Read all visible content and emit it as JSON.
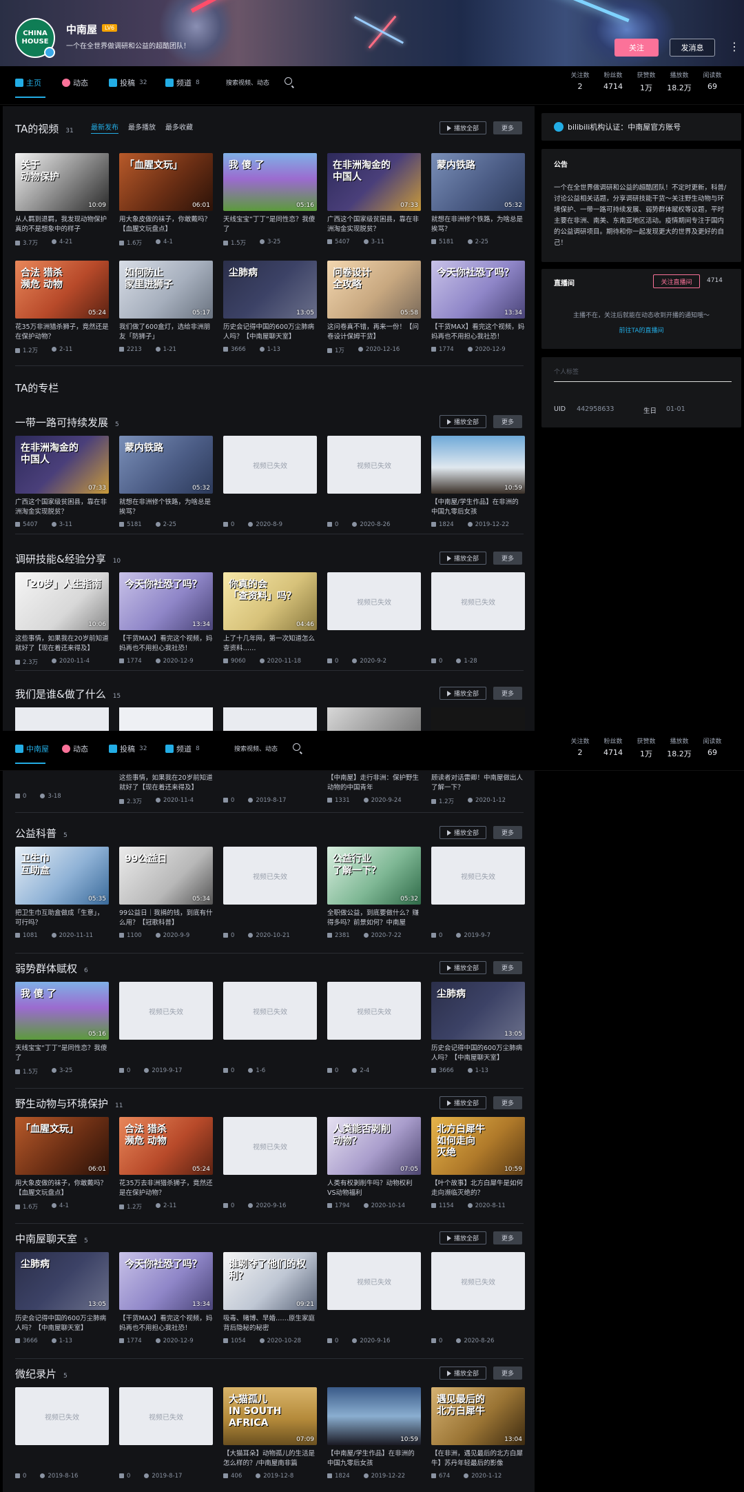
{
  "banner": {
    "avatar_text": "CHINA HOUSE",
    "name": "中南屋",
    "level": "LV6",
    "sign": "一个在全世界做调研和公益的超酷团队！"
  },
  "actions": {
    "follow": "关注",
    "message": "发消息",
    "more": "⋮"
  },
  "nav": {
    "items": [
      {
        "label": "主页",
        "count": ""
      },
      {
        "label": "动态",
        "count": ""
      },
      {
        "label": "投稿",
        "count": "32"
      },
      {
        "label": "频道",
        "count": "8"
      }
    ],
    "items2": [
      {
        "label": "中南屋",
        "count": ""
      },
      {
        "label": "动态",
        "count": ""
      },
      {
        "label": "投稿",
        "count": "32"
      },
      {
        "label": "频道",
        "count": "8"
      }
    ],
    "search_placeholder": "搜索视频、动态",
    "stats": [
      {
        "k": "关注数",
        "v": "2"
      },
      {
        "k": "粉丝数",
        "v": "4714"
      },
      {
        "k": "获赞数",
        "v": "1万"
      },
      {
        "k": "播放数",
        "v": "18.2万"
      },
      {
        "k": "阅读数",
        "v": "69"
      }
    ]
  },
  "videos_section": {
    "title": "TA的视频",
    "count": "31",
    "tabs": [
      "最新发布",
      "最多播放",
      "最多收藏"
    ],
    "play_all": "播放全部",
    "more": "更多"
  },
  "videos": [
    {
      "t": "从人羁到退羁，我发现动物保护真的不是想象中的样子",
      "thumb": "关于\n动物保护",
      "dur": "10:09",
      "p": "3.7万",
      "d": "4-21",
      "bg": "linear-gradient(135deg,#f2f2f2 0%,#9a9a9a 45%,#2a2a2a 100%)"
    },
    {
      "t": "用大象皮做的袜子，你敢戴吗？【血腥文玩盘点】",
      "thumb": "「血腥文玩」",
      "dur": "06:01",
      "p": "1.6万",
      "d": "4-1",
      "bg": "linear-gradient(135deg,#b85a2a 0%,#6a2e14 55%,#2b1208 100%)"
    },
    {
      "t": "天线宝宝“丁丁”是同性恋？我傻了",
      "thumb": "我 傻 了",
      "dur": "05:16",
      "p": "1.5万",
      "d": "3-25",
      "bg": "linear-gradient(180deg,#7fb0e6 0%,#9b6bcf 45%,#5c9b3c 100%)"
    },
    {
      "t": "广西这个国家级贫困县，靠在非洲淘金实现脱贫？",
      "thumb": "在非洲淘金的\n中国人",
      "dur": "07:33",
      "p": "5407",
      "d": "3-11",
      "bg": "linear-gradient(135deg,#2d2a5a 0%,#4a3f7a 50%,#c89a3a 100%)"
    },
    {
      "t": "就想在非洲修个铁路，为啥总是挨骂？",
      "thumb": "蒙内铁路",
      "dur": "05:32",
      "p": "5181",
      "d": "2-25",
      "bg": "linear-gradient(135deg,#7a8fb8 0%,#4c5d86 55%,#2c3a5a 100%)"
    },
    {
      "t": "花35万非洲猎杀狮子，竟然还是在保护动物？",
      "thumb": "合法 猎杀\n濒危 动物",
      "dur": "05:24",
      "p": "1.2万",
      "d": "2-11",
      "bg": "linear-gradient(135deg,#e8875a 0%,#b84a2a 55%,#5a2212 100%)"
    },
    {
      "t": "我们做了600盒灯，选给非洲朋友「防狮子」",
      "thumb": "如何防止\n家里进狮子",
      "dur": "05:17",
      "p": "2213",
      "d": "1-21",
      "bg": "linear-gradient(135deg,#d8dde6 0%,#a6afbd 55%,#6a7380 100%)"
    },
    {
      "t": "历史会记得中国的600万尘肺病人吗？【中南屋聊天室】",
      "thumb": "尘肺病",
      "dur": "13:05",
      "p": "3666",
      "d": "1-13",
      "bg": "linear-gradient(135deg,#2b2f4a 0%,#3c4266 50%,#6a6f8a 100%)"
    },
    {
      "t": "这问卷真不错，再来一份！【问卷设计保姆干货】",
      "thumb": "问卷设计\n全攻略",
      "dur": "05:58",
      "p": "1万",
      "d": "2020-12-16",
      "bg": "linear-gradient(135deg,#f3d7b0 0%,#c8a880 55%,#7a6a5a 100%)"
    },
    {
      "t": "【干货MAX】看完这个视频，妈妈再也不用担心我社恐！",
      "thumb": "今天你社恐了吗？",
      "dur": "13:34",
      "p": "1774",
      "d": "2020-12-9",
      "bg": "linear-gradient(135deg,#c8c2e8 0%,#8f86c8 55%,#4a4478 100%)"
    }
  ],
  "column_title": "TA的专栏",
  "collections": [
    {
      "title": "一带一路可持续发展",
      "count": "5",
      "cards": [
        {
          "t": "广西这个国家级贫困县，靠在非洲淘金实现脱贫？",
          "thumb": "在非洲淘金的\n中国人",
          "dur": "07:33",
          "p": "5407",
          "d": "3-11",
          "bg": "linear-gradient(135deg,#2d2a5a 0%,#4a3f7a 50%,#c89a3a 100%)",
          "inv": ""
        },
        {
          "t": "就想在非洲修个铁路，为啥总是挨骂？",
          "thumb": "蒙内铁路",
          "dur": "05:32",
          "p": "5181",
          "d": "2-25",
          "bg": "linear-gradient(135deg,#7a8fb8 0%,#4c5d86 55%,#2c3a5a 100%)",
          "inv": ""
        },
        {
          "t": "",
          "thumb": "",
          "dur": "",
          "p": "0",
          "d": "2020-8-9",
          "bg": "",
          "inv": "视频已失效"
        },
        {
          "t": "",
          "thumb": "",
          "dur": "",
          "p": "0",
          "d": "2020-8-26",
          "bg": "",
          "inv": "视频已失效"
        },
        {
          "t": "【中南屋/学生作品】在非洲的中国九零后女孩",
          "thumb": "",
          "dur": "10:59",
          "p": "1824",
          "d": "2019-12-22",
          "bg": "linear-gradient(180deg,#6fa9d8 0%,#e0e8ef 55%,#3a3028 100%)",
          "inv": ""
        }
      ]
    },
    {
      "title": "调研技能&经验分享",
      "count": "10",
      "cards": [
        {
          "t": "这些事情，如果我在20岁前知道就好了【现在着还来得及】",
          "thumb": "「20岁」人生指南",
          "dur": "10:06",
          "p": "2.3万",
          "d": "2020-11-4",
          "bg": "linear-gradient(135deg,#f5f5f5 0%,#d8d8d8 60%,#8a8a8a 100%)",
          "inv": ""
        },
        {
          "t": "【干货MAX】看完这个视频，妈妈再也不用担心我社恐！",
          "thumb": "今天你社恐了吗？",
          "dur": "13:34",
          "p": "1774",
          "d": "2020-12-9",
          "bg": "linear-gradient(135deg,#c8c2e8 0%,#8f86c8 55%,#4a4478 100%)",
          "inv": ""
        },
        {
          "t": "上了十几年网，第一次知道怎么查资料……",
          "thumb": "你真的会\n「查资料」吗？",
          "dur": "04:46",
          "p": "9060",
          "d": "2020-11-18",
          "bg": "linear-gradient(135deg,#f6e7a8 0%,#d7c27a 55%,#8a7a40 100%)",
          "inv": ""
        },
        {
          "t": "",
          "thumb": "",
          "dur": "",
          "p": "0",
          "d": "2020-9-2",
          "bg": "",
          "inv": "视频已失效"
        },
        {
          "t": "",
          "thumb": "",
          "dur": "",
          "p": "0",
          "d": "1-28",
          "bg": "",
          "inv": "视频已失效"
        }
      ]
    },
    {
      "title": "我们是谁&做了什么",
      "count": "15",
      "cards": []
    },
    {
      "title": "公益科普",
      "count": "5",
      "cards": [
        {
          "t": "把卫生巾互助盒做成「生意」，可行吗？",
          "thumb": "卫生巾\n互助盒",
          "dur": "05:35",
          "p": "1081",
          "d": "2020-11-11",
          "bg": "linear-gradient(135deg,#e6eef6 0%,#8fb2d6 55%,#3a6a9a 100%)",
          "inv": ""
        },
        {
          "t": "99公益日｜我捐的钱，到底有什么用？【冠歌科普】",
          "thumb": "99公益日",
          "dur": "05:34",
          "p": "1100",
          "d": "2020-9-9",
          "bg": "linear-gradient(135deg,#ebebeb 0%,#b8b8b8 60%,#555 100%)",
          "inv": ""
        },
        {
          "t": "",
          "thumb": "",
          "dur": "",
          "p": "0",
          "d": "2020-10-21",
          "bg": "",
          "inv": "视频已失效"
        },
        {
          "t": "全职做公益，到底要做什么？赚得多吗？前景如何？中南屋",
          "thumb": "公益行业\n了解一下？",
          "dur": "05:32",
          "p": "2381",
          "d": "2020-7-22",
          "bg": "linear-gradient(135deg,#d9efe0 0%,#7fb895 55%,#2f6a48 100%)",
          "inv": ""
        },
        {
          "t": "",
          "thumb": "",
          "dur": "",
          "p": "0",
          "d": "2019-9-7",
          "bg": "",
          "inv": "视频已失效"
        }
      ]
    },
    {
      "title": "弱势群体赋权",
      "count": "6",
      "cards": [
        {
          "t": "天线宝宝“丁丁”是同性恋？我傻了",
          "thumb": "我 傻 了",
          "dur": "05:16",
          "p": "1.5万",
          "d": "3-25",
          "bg": "linear-gradient(180deg,#7fb0e6 0%,#9b6bcf 45%,#5c9b3c 100%)",
          "inv": ""
        },
        {
          "t": "",
          "thumb": "",
          "dur": "",
          "p": "0",
          "d": "2019-9-17",
          "bg": "",
          "inv": "视频已失效"
        },
        {
          "t": "",
          "thumb": "",
          "dur": "",
          "p": "0",
          "d": "1-6",
          "bg": "",
          "inv": "视频已失效"
        },
        {
          "t": "",
          "thumb": "",
          "dur": "",
          "p": "0",
          "d": "2-4",
          "bg": "",
          "inv": "视频已失效"
        },
        {
          "t": "历史会记得中国的600万尘肺病人吗？【中南屋聊天室】",
          "thumb": "尘肺病",
          "dur": "13:05",
          "p": "3666",
          "d": "1-13",
          "bg": "linear-gradient(135deg,#2b2f4a 0%,#3c4266 50%,#6a6f8a 100%)",
          "inv": ""
        }
      ]
    },
    {
      "title": "野生动物与环境保护",
      "count": "11",
      "cards": [
        {
          "t": "用大象皮做的袜子，你敢戴吗？【血腥文玩盘点】",
          "thumb": "「血腥文玩」",
          "dur": "06:01",
          "p": "1.6万",
          "d": "4-1",
          "bg": "linear-gradient(135deg,#b85a2a 0%,#6a2e14 55%,#2b1208 100%)",
          "inv": ""
        },
        {
          "t": "花35万去非洲猎杀狮子，竟然还是在保护动物？",
          "thumb": "合法 猎杀\n濒危 动物",
          "dur": "05:24",
          "p": "1.2万",
          "d": "2-11",
          "bg": "linear-gradient(135deg,#e8875a 0%,#b84a2a 55%,#5a2212 100%)",
          "inv": ""
        },
        {
          "t": "",
          "thumb": "",
          "dur": "",
          "p": "0",
          "d": "2020-9-16",
          "bg": "",
          "inv": "视频已失效"
        },
        {
          "t": "人类有权剥削牛吗？动物权利VS动物福利",
          "thumb": "人类能否剥削\n动物？",
          "dur": "07:05",
          "p": "1794",
          "d": "2020-10-14",
          "bg": "linear-gradient(135deg,#e7e2f2 0%,#a99dcc 55%,#4d4670 100%)",
          "inv": ""
        },
        {
          "t": "【叶个故事】北方白犀牛是如何走向濒临灭绝的？",
          "thumb": "北方白犀牛\n如何走向\n灭绝",
          "dur": "10:59",
          "p": "1154",
          "d": "2020-8-11",
          "bg": "linear-gradient(135deg,#e6b44a 0%,#b07a2a 55%,#5a3a14 100%)",
          "inv": ""
        }
      ]
    },
    {
      "title": "中南屋聊天室",
      "count": "5",
      "cards": [
        {
          "t": "历史会记得中国的600万尘肺病人吗？【中南屋聊天室】",
          "thumb": "尘肺病",
          "dur": "13:05",
          "p": "3666",
          "d": "1-13",
          "bg": "linear-gradient(135deg,#2b2f4a 0%,#3c4266 50%,#6a6f8a 100%)",
          "inv": ""
        },
        {
          "t": "【干货MAX】看完这个视频，妈妈再也不用担心我社恐！",
          "thumb": "今天你社恐了吗？",
          "dur": "13:34",
          "p": "1774",
          "d": "2020-12-9",
          "bg": "linear-gradient(135deg,#c8c2e8 0%,#8f86c8 55%,#4a4478 100%)",
          "inv": ""
        },
        {
          "t": "吸毒、赌博、早婚……原生家庭背后隐秘的秘密",
          "thumb": "谁剥夺了他们的权利？",
          "dur": "09:21",
          "p": "1054",
          "d": "2020-10-28",
          "bg": "linear-gradient(135deg,#f4f4f4 0%,#bfc7d4 55%,#5a6478 100%)",
          "inv": ""
        },
        {
          "t": "",
          "thumb": "",
          "dur": "",
          "p": "0",
          "d": "2020-9-16",
          "bg": "",
          "inv": "视频已失效"
        },
        {
          "t": "",
          "thumb": "",
          "dur": "",
          "p": "0",
          "d": "2020-8-26",
          "bg": "",
          "inv": "视频已失效"
        }
      ]
    },
    {
      "title": "微纪录片",
      "count": "5",
      "cards": [
        {
          "t": "",
          "thumb": "",
          "dur": "",
          "p": "0",
          "d": "2019-8-16",
          "bg": "",
          "inv": "视频已失效"
        },
        {
          "t": "",
          "thumb": "",
          "dur": "",
          "p": "0",
          "d": "2019-8-17",
          "bg": "",
          "inv": "视频已失效"
        },
        {
          "t": "【大猫耳朵】动物孤儿的生活是怎么样的？/中南屋南非篇",
          "thumb": "大猫孤儿\nIN SOUTH AFRICA",
          "dur": "07:09",
          "p": "406",
          "d": "2019-12-8",
          "bg": "linear-gradient(180deg,#d9b46a 0%,#b48a3a 55%,#6a5020 100%)",
          "inv": ""
        },
        {
          "t": "【中南屋/学生作品】在非洲的中国九零后女孩",
          "thumb": "",
          "dur": "10:59",
          "p": "1824",
          "d": "2019-12-22",
          "bg": "linear-gradient(180deg,#3a5a88 0%,#8aaed0 50%,#1a1a24 100%)",
          "inv": ""
        },
        {
          "t": "【在非洲，遇见最后的北方白犀牛】苏丹年轻最后的影像",
          "thumb": "遇见最后的\n北方白犀牛",
          "dur": "13:04",
          "p": "674",
          "d": "2020-1-12",
          "bg": "linear-gradient(135deg,#d6b272 0%,#9a7434 55%,#3c2a10 100%)",
          "inv": ""
        }
      ]
    }
  ],
  "partial_row": [
    {
      "t": "这些事情，如果我在20岁前知道就好了【现在着还来得及】",
      "p": "2.3万",
      "d": "2020-11-4"
    },
    {
      "t": "",
      "p": "0",
      "d": "2019-8-17"
    },
    {
      "t": "【中南屋】走行非洲：保护野生动物的中国青年",
      "p": "1331",
      "d": "2020-9-24"
    },
    {
      "t": "顾读者对话雷卿！中南屋做出人了解一下？",
      "p": "1.2万",
      "d": "2020-1-12"
    }
  ],
  "partial_first": {
    "p": "0",
    "d": "3-18"
  },
  "side": {
    "verify": "bilibili机构认证：中南屋官方账号",
    "notice_title": "公告",
    "notice": "一个在全世界做调研和公益的超酷团队！不定时更新，科普/讨论公益相关话题，分享调研技能干货～关注野生动物与环境保护、一带一路可持续发展、弱势群体赋权等议题，平时主要在非洲、南美、东南亚地区活动。疫情期间专注于国内的公益调研项目。期待和你一起发现更大的世界及更好的自己！",
    "live_title": "直播间",
    "live_btn": "关注直播间",
    "live_count": "4714",
    "live_empty": "主播不在，关注后就能在动态收到开播的通知哦～",
    "live_link": "前往TA的直播间",
    "tags_placeholder": "个人标签",
    "uid_label": "UID",
    "uid": "442958633",
    "birth_label": "生日",
    "birth": "01-01"
  },
  "colors": {
    "accent": "#23ade5",
    "pink": "#fb7299"
  }
}
